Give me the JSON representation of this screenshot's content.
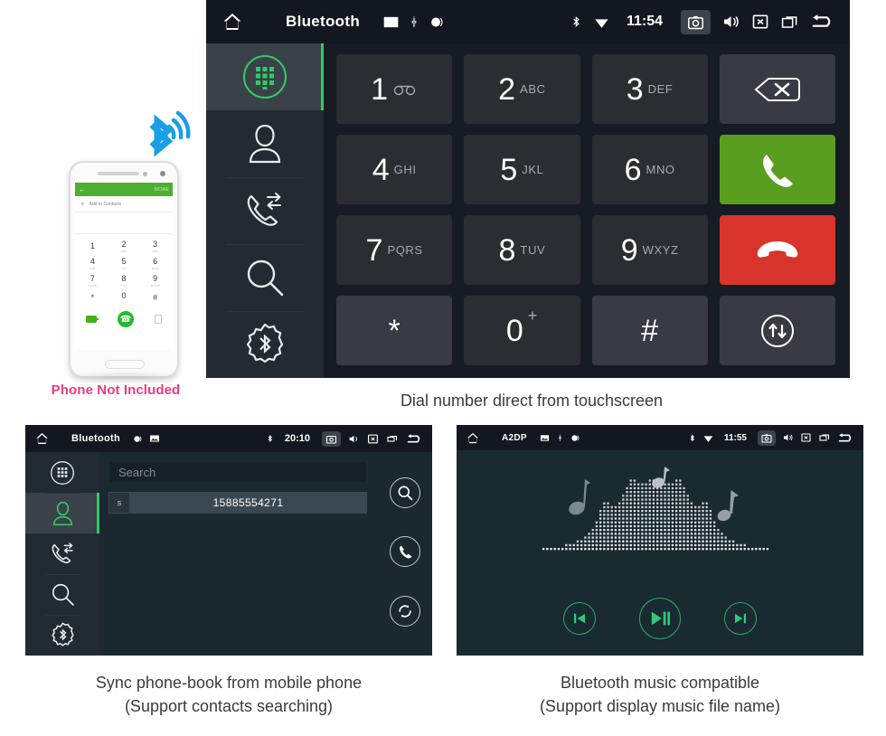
{
  "phone_mockup": {
    "header": {
      "back_icon": "back-arrow-icon",
      "more_label": "MORE"
    },
    "add_contacts_label": "Add to Contacts",
    "keys": [
      {
        "num": "1",
        "sub": ""
      },
      {
        "num": "2",
        "sub": "ABC"
      },
      {
        "num": "3",
        "sub": "DEF"
      },
      {
        "num": "4",
        "sub": "GHI"
      },
      {
        "num": "5",
        "sub": "JKL"
      },
      {
        "num": "6",
        "sub": "MNO"
      },
      {
        "num": "7",
        "sub": "PQRS"
      },
      {
        "num": "8",
        "sub": "TUV"
      },
      {
        "num": "9",
        "sub": "WXYZ"
      },
      {
        "num": "*",
        "sub": ""
      },
      {
        "num": "0",
        "sub": "+"
      },
      {
        "num": "#",
        "sub": ""
      }
    ],
    "disclaimer": "Phone Not Included",
    "disclaimer_color": "#ec3a80",
    "bluetooth_logo_color": "#1a9ee8",
    "call_button_color": "#21bd2b"
  },
  "main_unit": {
    "status": {
      "home_icon": "home-icon",
      "title": "Bluetooth",
      "left_icons": [
        "picture-icon",
        "usb-icon",
        "media-icon"
      ],
      "bluetooth_icon": "bluetooth-icon",
      "wifi_icon": "wifi-icon",
      "time": "11:54",
      "right_icons": [
        "camera-icon",
        "volume-icon",
        "close-icon",
        "recents-icon",
        "back-icon"
      ]
    },
    "sidebar": [
      {
        "name": "dialpad",
        "icon": "dialpad-icon",
        "active": true
      },
      {
        "name": "contacts",
        "icon": "contact-person-icon",
        "active": false
      },
      {
        "name": "call-log",
        "icon": "call-log-icon",
        "active": false
      },
      {
        "name": "search",
        "icon": "search-icon",
        "active": false
      },
      {
        "name": "bluetooth-settings",
        "icon": "bluetooth-gear-icon",
        "active": false
      }
    ],
    "keypad": [
      {
        "num": "1",
        "sub": "",
        "style": "dark",
        "icon": "voicemail-icon"
      },
      {
        "num": "2",
        "sub": "ABC",
        "style": "dark",
        "icon": ""
      },
      {
        "num": "3",
        "sub": "DEF",
        "style": "dark",
        "icon": ""
      },
      {
        "num": "",
        "sub": "",
        "style": "plain",
        "icon": "backspace-icon"
      },
      {
        "num": "4",
        "sub": "GHI",
        "style": "dark",
        "icon": ""
      },
      {
        "num": "5",
        "sub": "JKL",
        "style": "dark",
        "icon": ""
      },
      {
        "num": "6",
        "sub": "MNO",
        "style": "dark",
        "icon": ""
      },
      {
        "num": "",
        "sub": "",
        "style": "green",
        "icon": "call-icon"
      },
      {
        "num": "7",
        "sub": "PQRS",
        "style": "dark",
        "icon": ""
      },
      {
        "num": "8",
        "sub": "TUV",
        "style": "dark",
        "icon": ""
      },
      {
        "num": "9",
        "sub": "WXYZ",
        "style": "dark",
        "icon": ""
      },
      {
        "num": "",
        "sub": "",
        "style": "red",
        "icon": "end-call-icon"
      },
      {
        "num": "*",
        "sub": "",
        "style": "plain",
        "icon": ""
      },
      {
        "num": "0",
        "sub": "+",
        "style": "dark",
        "icon": ""
      },
      {
        "num": "#",
        "sub": "",
        "style": "plain",
        "icon": ""
      },
      {
        "num": "",
        "sub": "",
        "style": "plain",
        "icon": "transfer-audio-icon"
      }
    ],
    "accent_green": "#5a9e1f",
    "accent_red": "#d9342b",
    "active_green": "#2ecc62"
  },
  "contacts_unit": {
    "status": {
      "home_icon": "home-icon",
      "title": "Bluetooth",
      "left_icons": [
        "media-icon",
        "picture-icon"
      ],
      "bluetooth_icon": "bluetooth-icon",
      "time": "20:10",
      "right_icons": [
        "camera-icon",
        "volume-icon",
        "close-icon",
        "recents-icon",
        "back-icon"
      ]
    },
    "sidebar": [
      {
        "name": "dialpad",
        "icon": "dialpad-icon",
        "active": false
      },
      {
        "name": "contacts",
        "icon": "contact-person-icon",
        "active": true
      },
      {
        "name": "call-log",
        "icon": "call-log-icon",
        "active": false
      },
      {
        "name": "search",
        "icon": "search-icon",
        "active": false
      },
      {
        "name": "bluetooth-settings",
        "icon": "bluetooth-gear-icon",
        "active": false
      }
    ],
    "search_placeholder": "Search",
    "contacts": [
      {
        "initial": "s",
        "number": "15885554271"
      }
    ],
    "rail_buttons": [
      "search-icon",
      "call-icon",
      "sync-icon"
    ]
  },
  "music_unit": {
    "status": {
      "home_icon": "home-icon",
      "title": "A2DP",
      "left_icons": [
        "picture-icon",
        "usb-icon",
        "media-icon"
      ],
      "bluetooth_icon": "bluetooth-icon",
      "wifi_icon": "wifi-icon",
      "time": "11:55",
      "right_icons": [
        "camera-icon",
        "volume-icon",
        "close-icon",
        "recents-icon",
        "back-icon"
      ]
    },
    "controls": [
      {
        "name": "previous",
        "icon": "previous-track-icon"
      },
      {
        "name": "play-pause",
        "icon": "play-pause-icon"
      },
      {
        "name": "next",
        "icon": "next-track-icon"
      }
    ],
    "visualizer_label": "music-equalizer-visualizer",
    "accent_green": "#2fa86a"
  },
  "captions": {
    "main": "Dial number direct from touchscreen",
    "left_line1": "Sync phone-book from mobile phone",
    "left_line2": "(Support contacts searching)",
    "right_line1": "Bluetooth music compatible",
    "right_line2": "(Support display music file name)"
  }
}
